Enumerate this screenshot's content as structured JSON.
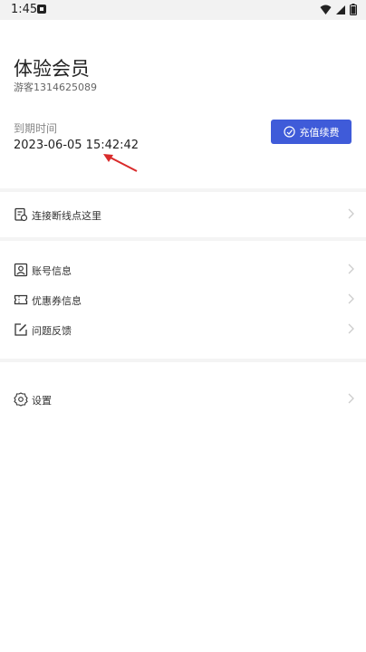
{
  "status_bar": {
    "time": "1:45"
  },
  "membership": {
    "title": "体验会员",
    "guest_id": "游客1314625089",
    "expire_label": "到期时间",
    "expire_value": "2023-06-05 15:42:42",
    "recharge_label": "充值续费",
    "accent_color": "#3f5bd9"
  },
  "menu": {
    "reconnect": {
      "label": "连接断线点这里",
      "icon": "document-settings-icon"
    },
    "account": {
      "label": "账号信息",
      "icon": "profile-card-icon"
    },
    "coupon": {
      "label": "优惠券信息",
      "icon": "ticket-icon"
    },
    "feedback": {
      "label": "问题反馈",
      "icon": "edit-icon"
    },
    "settings": {
      "label": "设置",
      "icon": "gear-icon"
    }
  }
}
